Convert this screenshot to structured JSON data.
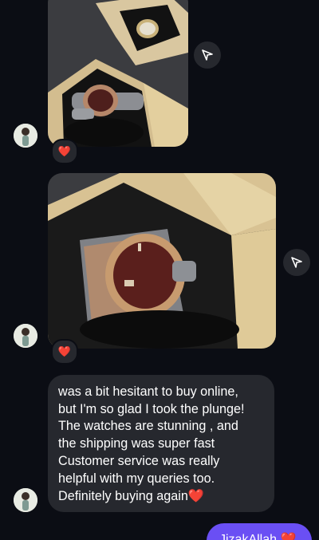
{
  "messages": [
    {
      "type": "image",
      "description_icon": "share-icon",
      "reaction": "❤️"
    },
    {
      "type": "image",
      "description_icon": "share-icon",
      "reaction": "❤️"
    },
    {
      "type": "text",
      "lines": [
        "was a bit hesitant to buy online,",
        "but I'm so glad I took the plunge!",
        "The watches are stunning , and",
        "the shipping was super fast",
        "Customer service was really",
        "helpful with my queries too.",
        "Definitely buying again"
      ],
      "trailing_emoji": "❤️"
    }
  ],
  "outgoing": {
    "text": "JizakAllah",
    "emoji": "❤️"
  },
  "colors": {
    "background": "#0b0d14",
    "incoming_bubble": "#26282e",
    "outgoing_bubble": "#6a4ff4",
    "heart": "#ff2d3a"
  }
}
